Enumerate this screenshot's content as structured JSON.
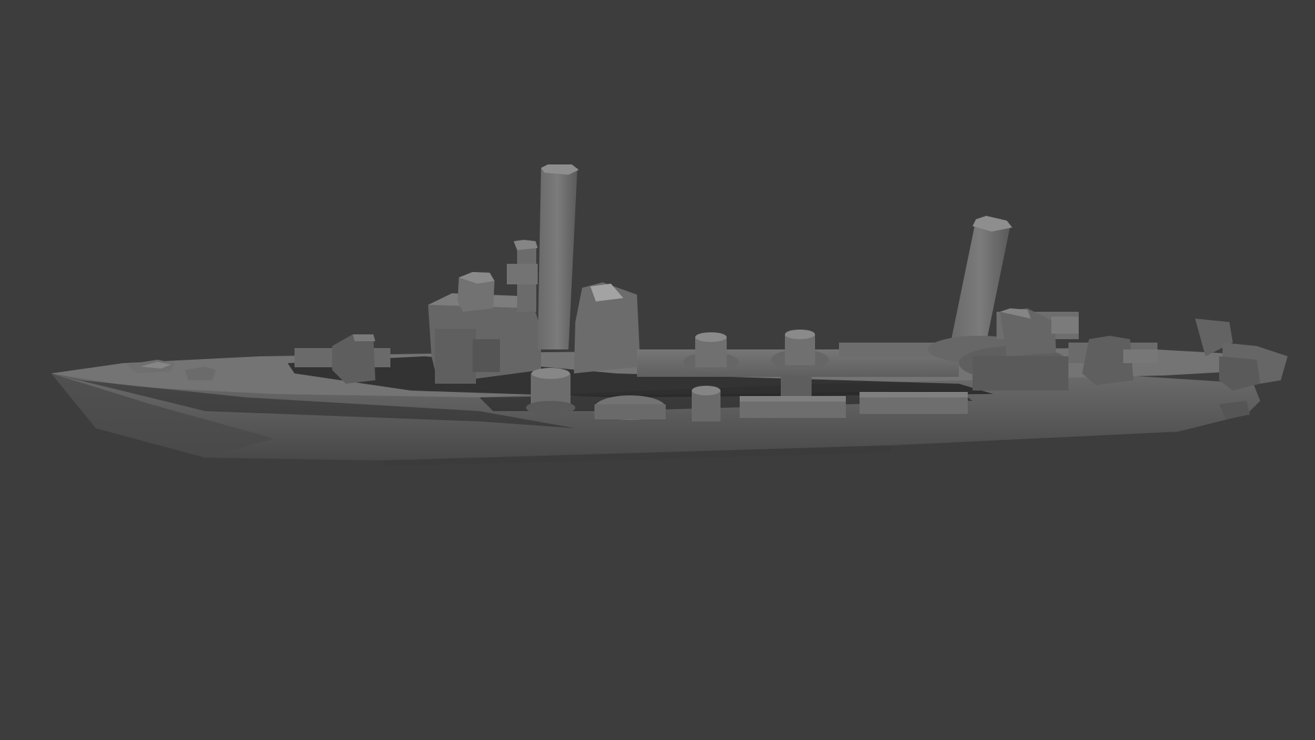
{
  "scene": {
    "background_color": "#3d3d3d",
    "model_base_color": "#6e6e6e",
    "model_light_color": "#8a8a8a",
    "model_shadow_color": "#262626",
    "subject": "render"
  }
}
